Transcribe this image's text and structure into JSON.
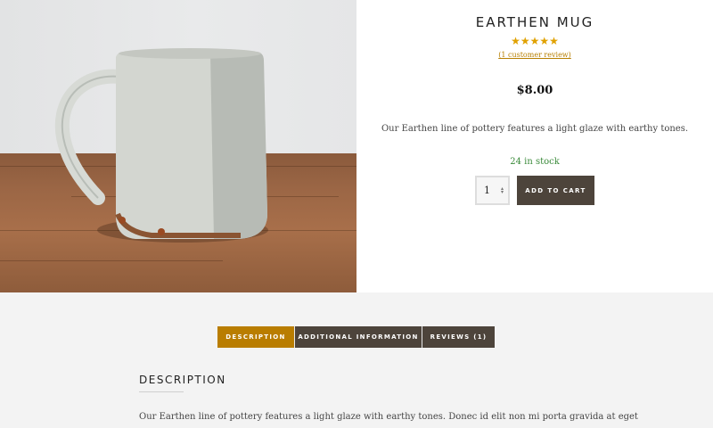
{
  "product": {
    "title": "EARTHEN MUG",
    "stars": "★★★★★",
    "review_link": "(1 customer review)",
    "price": "$8.00",
    "short_description": "Our Earthen line of pottery features a light glaze with earthy tones.",
    "stock": "24 in stock",
    "quantity": "1",
    "add_to_cart_label": "ADD TO CART",
    "colors": {
      "star": "#e0a100",
      "stock": "#3a8a3a",
      "button": "#4d443b",
      "accent": "#b97d00"
    }
  },
  "tabs": [
    {
      "label": "DESCRIPTION",
      "active": true
    },
    {
      "label": "ADDITIONAL INFORMATION",
      "active": false
    },
    {
      "label": "REVIEWS (1)",
      "active": false
    }
  ],
  "description_section": {
    "heading": "DESCRIPTION",
    "text": "Our Earthen line of pottery features a light glaze with earthy tones. Donec id elit non mi porta gravida at eget"
  }
}
